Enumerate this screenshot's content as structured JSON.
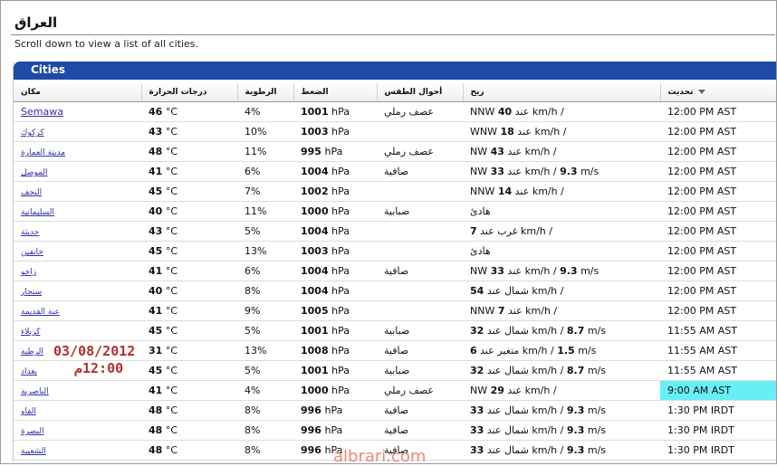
{
  "header": {
    "title": "العراق",
    "subtitle": "Scroll down to view a list of all cities."
  },
  "panel": {
    "title": "Cities"
  },
  "columns": [
    "مكان",
    "درجات الحرارة",
    "الرطوبة",
    "الضغط",
    "أحوال الطقس",
    "ريح",
    "تحديث"
  ],
  "rows": [
    {
      "city": "Semawa",
      "temp": "46",
      "unit_temp": "°C",
      "hum": "4%",
      "press": "1001",
      "unit_press": "hPa",
      "cond": "عصف رملي",
      "wind_dir": "NNW",
      "wind_val": "40",
      "wind_mid": "عند",
      "wind_unit": "km/h /",
      "ms": "",
      "ms_unit": "",
      "time": "12:00 PM AST",
      "hl": false,
      "small": false
    },
    {
      "city": "كركوك",
      "temp": "43",
      "unit_temp": "°C",
      "hum": "10%",
      "press": "1003",
      "unit_press": "hPa",
      "cond": "",
      "wind_dir": "WNW",
      "wind_val": "18",
      "wind_mid": "عند",
      "wind_unit": "km/h /",
      "ms": "",
      "ms_unit": "",
      "time": "12:00 PM AST",
      "hl": false,
      "small": true
    },
    {
      "city": "مدينة العمارة",
      "temp": "48",
      "unit_temp": "°C",
      "hum": "11%",
      "press": "995",
      "unit_press": "hPa",
      "cond": "عصف رملي",
      "wind_dir": "NW",
      "wind_val": "43",
      "wind_mid": "عند",
      "wind_unit": "km/h /",
      "ms": "",
      "ms_unit": "",
      "time": "12:00 PM AST",
      "hl": false,
      "small": true
    },
    {
      "city": "الموصل",
      "temp": "41",
      "unit_temp": "°C",
      "hum": "6%",
      "press": "1004",
      "unit_press": "hPa",
      "cond": "صافية",
      "wind_dir": "NW",
      "wind_val": "33",
      "wind_mid": "عند",
      "wind_unit": "km/h /",
      "ms": "9.3",
      "ms_unit": "m/s",
      "time": "12:00 PM AST",
      "hl": false,
      "small": true
    },
    {
      "city": "النجف",
      "temp": "45",
      "unit_temp": "°C",
      "hum": "7%",
      "press": "1002",
      "unit_press": "hPa",
      "cond": "",
      "wind_dir": "NNW",
      "wind_val": "14",
      "wind_mid": "عند",
      "wind_unit": "km/h /",
      "ms": "",
      "ms_unit": "",
      "time": "12:00 PM AST",
      "hl": false,
      "small": true
    },
    {
      "city": "السليمانية",
      "temp": "40",
      "unit_temp": "°C",
      "hum": "11%",
      "press": "1000",
      "unit_press": "hPa",
      "cond": "ضبابية",
      "wind_dir": "",
      "wind_val": "",
      "wind_mid": "هادئ",
      "wind_unit": "",
      "ms": "",
      "ms_unit": "",
      "time": "12:00 PM AST",
      "hl": false,
      "small": true
    },
    {
      "city": "حديثة",
      "temp": "43",
      "unit_temp": "°C",
      "hum": "5%",
      "press": "1004",
      "unit_press": "hPa",
      "cond": "",
      "wind_dir": "",
      "wind_val": "7",
      "wind_mid": "غرب عند",
      "wind_unit": "km/h /",
      "ms": "",
      "ms_unit": "",
      "time": "12:00 PM AST",
      "hl": false,
      "small": true
    },
    {
      "city": "خانقين",
      "temp": "45",
      "unit_temp": "°C",
      "hum": "13%",
      "press": "1003",
      "unit_press": "hPa",
      "cond": "",
      "wind_dir": "",
      "wind_val": "",
      "wind_mid": "هادئ",
      "wind_unit": "",
      "ms": "",
      "ms_unit": "",
      "time": "12:00 PM AST",
      "hl": false,
      "small": true
    },
    {
      "city": "زاخو",
      "temp": "41",
      "unit_temp": "°C",
      "hum": "6%",
      "press": "1004",
      "unit_press": "hPa",
      "cond": "صافية",
      "wind_dir": "NW",
      "wind_val": "33",
      "wind_mid": "عند",
      "wind_unit": "km/h /",
      "ms": "9.3",
      "ms_unit": "m/s",
      "time": "12:00 PM AST",
      "hl": false,
      "small": true
    },
    {
      "city": "سنجار",
      "temp": "40",
      "unit_temp": "°C",
      "hum": "8%",
      "press": "1004",
      "unit_press": "hPa",
      "cond": "",
      "wind_dir": "",
      "wind_val": "54",
      "wind_mid": "شمال عند",
      "wind_unit": "km/h /",
      "ms": "",
      "ms_unit": "",
      "time": "12:00 PM AST",
      "hl": false,
      "small": true
    },
    {
      "city": "عنة القديمة",
      "temp": "41",
      "unit_temp": "°C",
      "hum": "9%",
      "press": "1005",
      "unit_press": "hPa",
      "cond": "",
      "wind_dir": "NNW",
      "wind_val": "7",
      "wind_mid": "عند",
      "wind_unit": "km/h /",
      "ms": "",
      "ms_unit": "",
      "time": "12:00 PM AST",
      "hl": false,
      "small": true
    },
    {
      "city": "كربلاء",
      "temp": "45",
      "unit_temp": "°C",
      "hum": "5%",
      "press": "1001",
      "unit_press": "hPa",
      "cond": "ضبابية",
      "wind_dir": "",
      "wind_val": "32",
      "wind_mid": "شمال عند",
      "wind_unit": "km/h /",
      "ms": "8.7",
      "ms_unit": "m/s",
      "time": "11:55 AM AST",
      "hl": false,
      "small": true
    },
    {
      "city": "الرطبة",
      "temp": "31",
      "unit_temp": "°C",
      "hum": "13%",
      "press": "1008",
      "unit_press": "hPa",
      "cond": "صافية",
      "wind_dir": "",
      "wind_val": "6",
      "wind_mid": "متغير عند",
      "wind_unit": "km/h /",
      "ms": "1.5",
      "ms_unit": "m/s",
      "time": "11:55 AM AST",
      "hl": false,
      "small": true
    },
    {
      "city": "بغداد",
      "temp": "45",
      "unit_temp": "°C",
      "hum": "5%",
      "press": "1001",
      "unit_press": "hPa",
      "cond": "ضبابية",
      "wind_dir": "",
      "wind_val": "32",
      "wind_mid": "شمال عند",
      "wind_unit": "km/h /",
      "ms": "8.7",
      "ms_unit": "m/s",
      "time": "11:55 AM AST",
      "hl": false,
      "small": true
    },
    {
      "city": "الناصرية",
      "temp": "41",
      "unit_temp": "°C",
      "hum": "4%",
      "press": "1000",
      "unit_press": "hPa",
      "cond": "عصف رملي",
      "wind_dir": "NW",
      "wind_val": "29",
      "wind_mid": "عند",
      "wind_unit": "km/h /",
      "ms": "",
      "ms_unit": "",
      "time": "9:00 AM AST",
      "hl": true,
      "small": true
    },
    {
      "city": "الفاو",
      "temp": "48",
      "unit_temp": "°C",
      "hum": "8%",
      "press": "996",
      "unit_press": "hPa",
      "cond": "صافية",
      "wind_dir": "",
      "wind_val": "33",
      "wind_mid": "شمال عند",
      "wind_unit": "km/h /",
      "ms": "9.3",
      "ms_unit": "m/s",
      "time": "1:30 PM IRDT",
      "hl": false,
      "small": true
    },
    {
      "city": "البصرة",
      "temp": "48",
      "unit_temp": "°C",
      "hum": "8%",
      "press": "996",
      "unit_press": "hPa",
      "cond": "صافية",
      "wind_dir": "",
      "wind_val": "33",
      "wind_mid": "شمال عند",
      "wind_unit": "km/h /",
      "ms": "9.3",
      "ms_unit": "m/s",
      "time": "1:30 PM IRDT",
      "hl": false,
      "small": true
    },
    {
      "city": "الشعيبة",
      "temp": "48",
      "unit_temp": "°C",
      "hum": "8%",
      "press": "996",
      "unit_press": "hPa",
      "cond": "صافية",
      "wind_dir": "",
      "wind_val": "33",
      "wind_mid": "شمال عند",
      "wind_unit": "km/h /",
      "ms": "9.3",
      "ms_unit": "m/s",
      "time": "1:30 PM IRDT",
      "hl": false,
      "small": true
    }
  ],
  "overlay": {
    "date": "03/08/2012",
    "time": "12:00م",
    "site": "albrari.com"
  },
  "colors": {
    "header_bar": "#1f4aa6",
    "link": "#3232a8",
    "highlight": "#66f0f5",
    "overlay_text": "#b03030"
  }
}
